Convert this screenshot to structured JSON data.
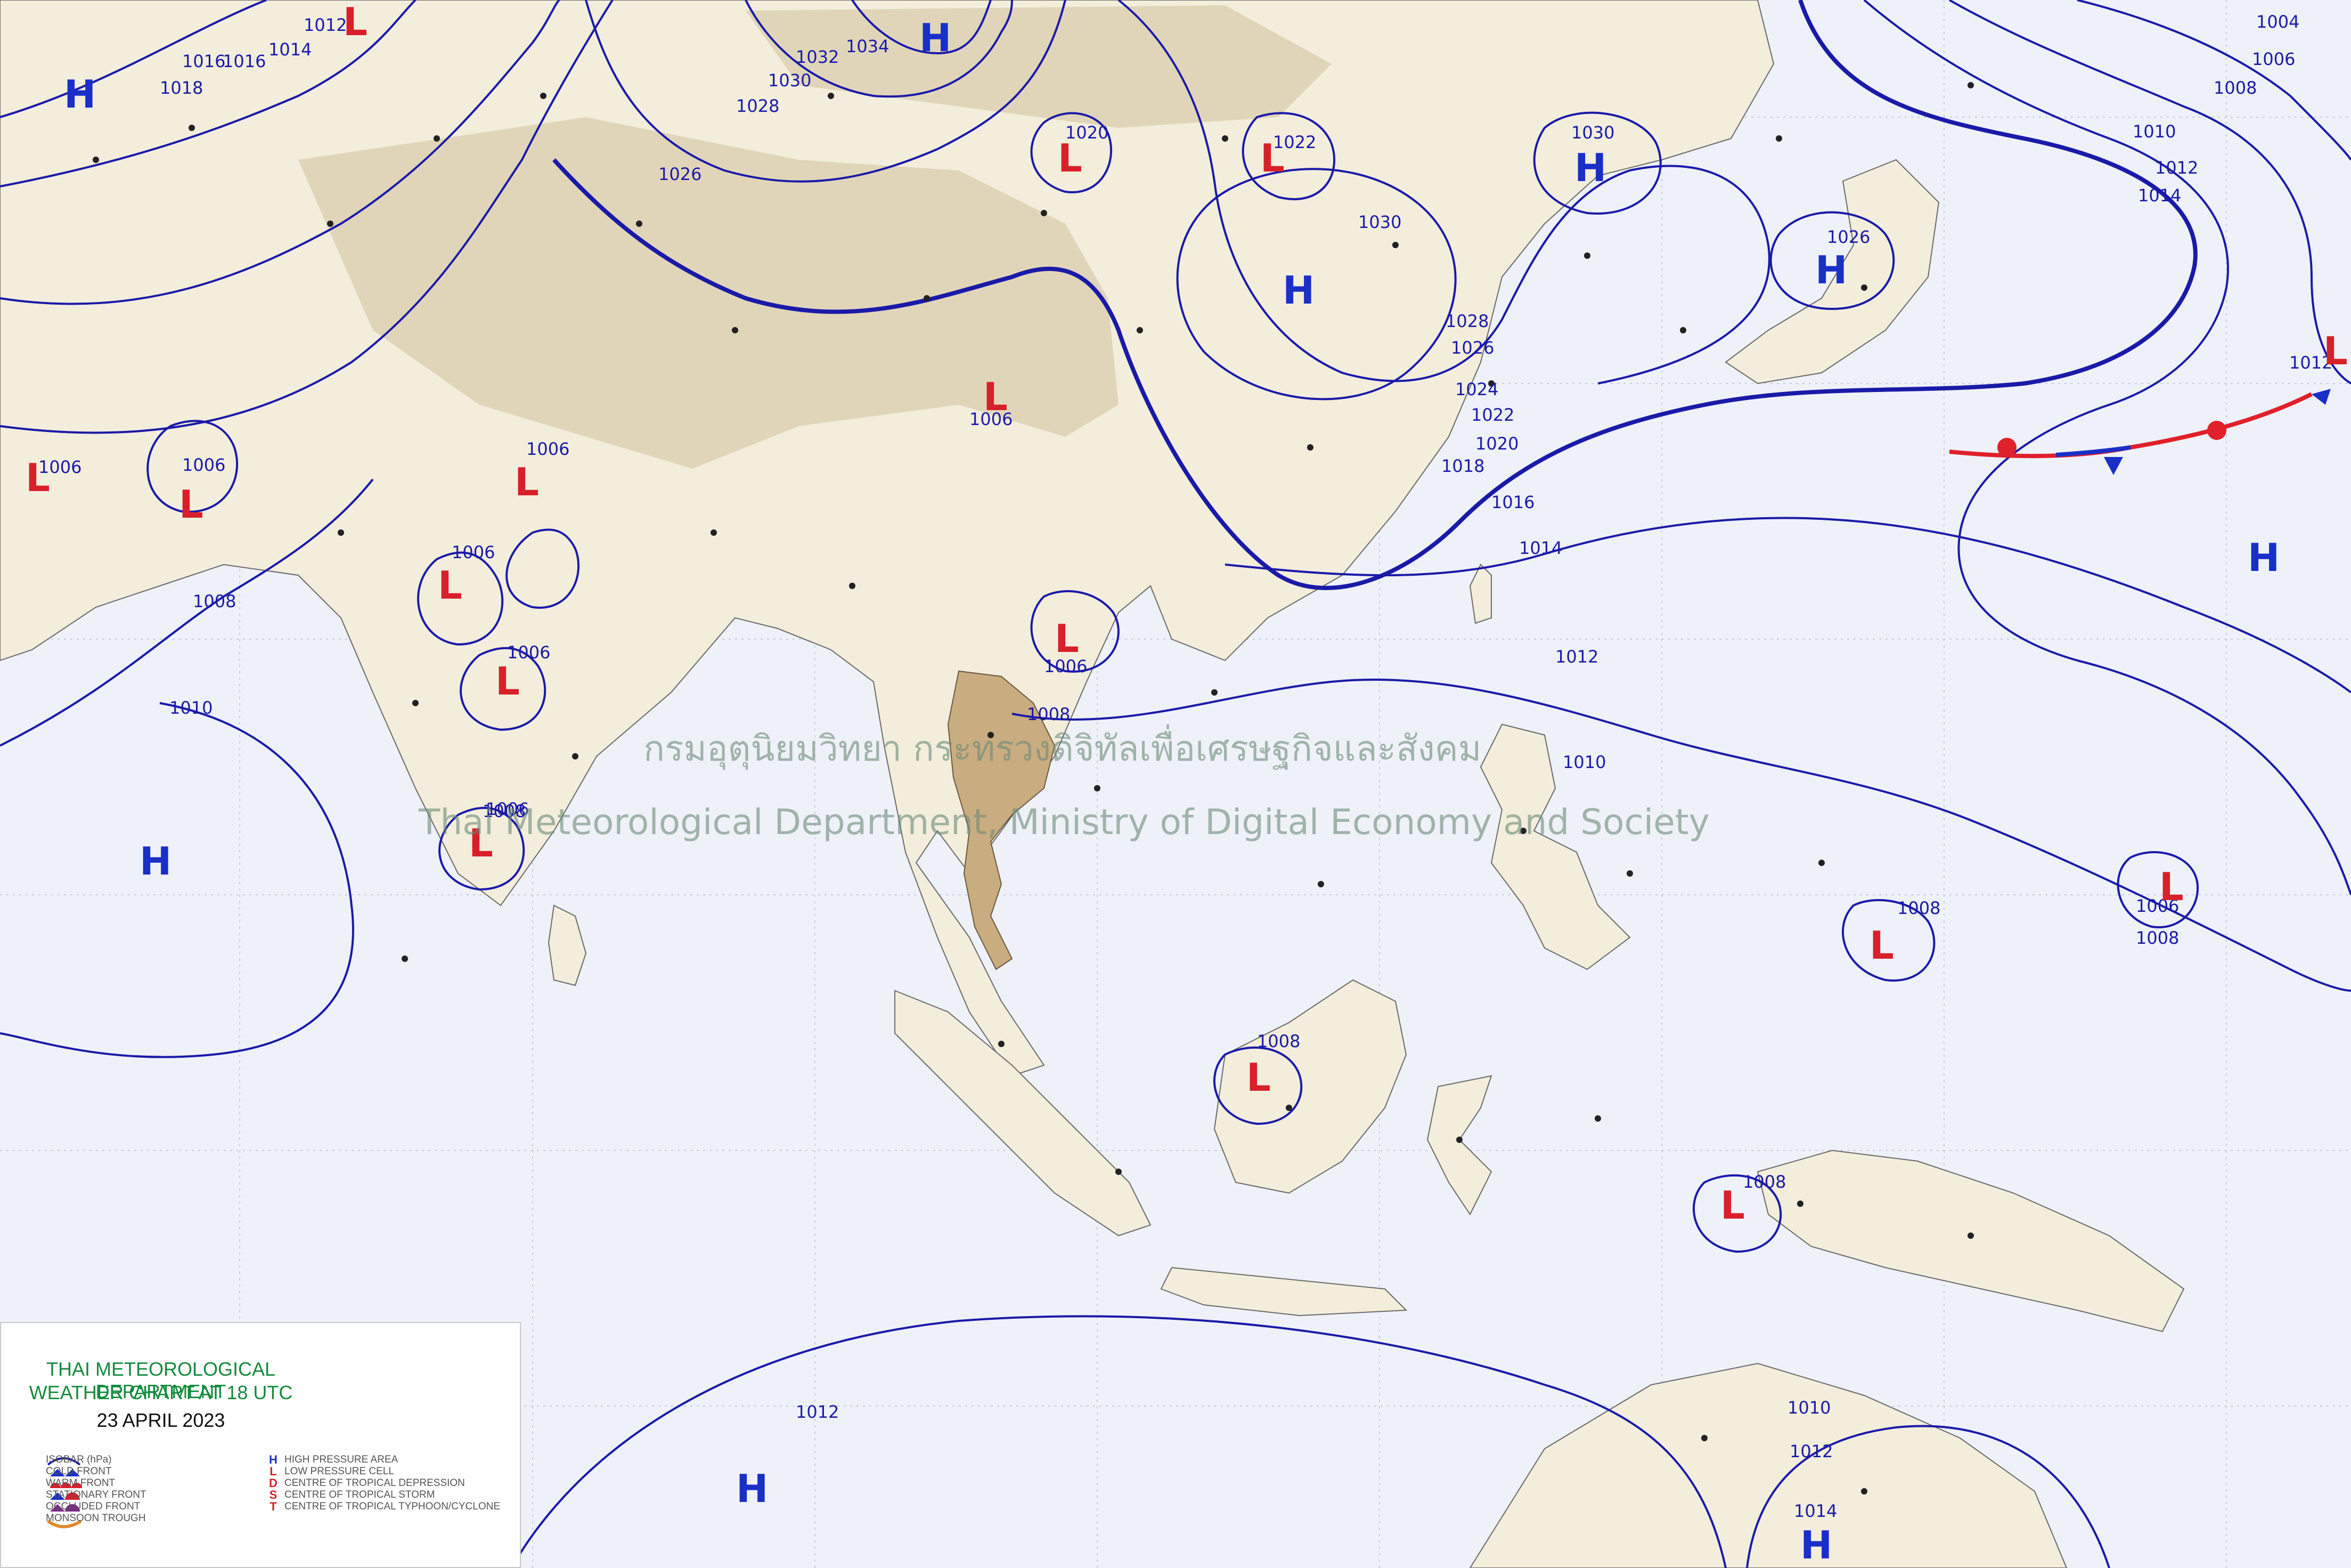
{
  "watermark": {
    "thai": "กรมอุตุนิยมวิทยา กระทรวงดิจิทัลเพื่อเศรษฐกิจและสังคม",
    "english": "Thai Meteorological Department, Ministry of Digital Economy and Society"
  },
  "legend": {
    "agency": "THAI METEOROLOGICAL DEPARTMENT",
    "chart_time": "WEATHER CHART AT   18   UTC",
    "chart_date": "23 APRIL 2023",
    "line_items": [
      "ISOBAR (hPa)",
      "COLD FRONT",
      "WARM FRONT",
      "STATIONARY FRONT",
      "OCCLUDED FRONT",
      "MONSOON TROUGH"
    ],
    "center_items": [
      {
        "symbol": "H",
        "color": "#1a2fc8",
        "label": "HIGH PRESSURE AREA"
      },
      {
        "symbol": "L",
        "color": "#d8202a",
        "label": "LOW PRESSURE CELL"
      },
      {
        "symbol": "D",
        "color": "#d8202a",
        "label": "CENTRE OF TROPICAL DEPRESSION"
      },
      {
        "symbol": "S",
        "color": "#d8202a",
        "label": "CENTRE OF TROPICAL STORM"
      },
      {
        "symbol": "T",
        "color": "#d8202a",
        "label": "CENTRE OF TROPICAL TYPHOON/CYCLONE"
      }
    ]
  },
  "isobar_labels": [
    "1012",
    "1016",
    "1014",
    "1018",
    "1016",
    "1032",
    "1034",
    "1030",
    "1028",
    "1026",
    "1020",
    "1022",
    "1030",
    "1026",
    "1004",
    "1006",
    "1008",
    "1010",
    "1012",
    "1014",
    "1030",
    "1028",
    "1026",
    "1024",
    "1022",
    "1020",
    "1018",
    "1016",
    "1014",
    "1012",
    "1012",
    "1006",
    "1006",
    "1006",
    "1008",
    "1006",
    "1006",
    "1006",
    "1008",
    "1006",
    "1008",
    "1010",
    "1010",
    "1006",
    "1008",
    "1008",
    "1008",
    "1006",
    "1008",
    "1012",
    "1010",
    "1012",
    "1014"
  ],
  "pressure_centers": [
    {
      "type": "H"
    },
    {
      "type": "L"
    },
    {
      "type": "H"
    },
    {
      "type": "L"
    },
    {
      "type": "L"
    },
    {
      "type": "H"
    },
    {
      "type": "H"
    },
    {
      "type": "H"
    },
    {
      "type": "L"
    },
    {
      "type": "L"
    },
    {
      "type": "L"
    },
    {
      "type": "L"
    },
    {
      "type": "L"
    },
    {
      "type": "L"
    },
    {
      "type": "L"
    },
    {
      "type": "L"
    },
    {
      "type": "H"
    },
    {
      "type": "L"
    },
    {
      "type": "L"
    },
    {
      "type": "H"
    },
    {
      "type": "L"
    },
    {
      "type": "L"
    },
    {
      "type": "L"
    },
    {
      "type": "H"
    },
    {
      "type": "H"
    },
    {
      "type": "L"
    }
  ],
  "colors": {
    "isobar": "#1a1aa8",
    "high": "#1a2fc8",
    "low": "#d8202a",
    "warm_front": "#e0202a",
    "cold_front": "#1a2fc8",
    "ocean": "#eef1f7",
    "land": "#f3eddc",
    "legend_title": "#148a3c"
  }
}
